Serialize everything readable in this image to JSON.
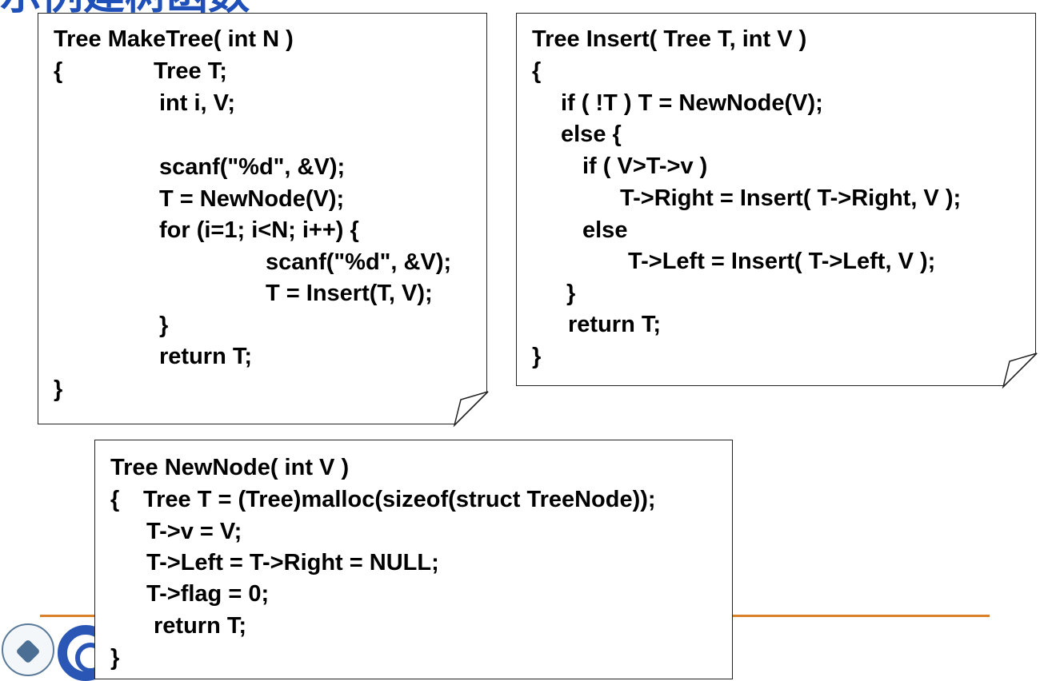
{
  "slide": {
    "title_fragment": "示例建树函数"
  },
  "make_tree": {
    "lines": [
      "Tree MakeTree( int N )",
      "{",
      "Tree T;",
      "int i, V;",
      "scanf(\"%d\", &V);",
      "T = NewNode(V);",
      "for (i=1; i<N; i++) {",
      "scanf(\"%d\", &V);",
      "T = Insert(T, V);",
      "}",
      "return T;",
      "}"
    ]
  },
  "insert": {
    "lines": [
      "Tree Insert( Tree T, int V )",
      "{",
      "if ( !T ) T = NewNode(V);",
      "else {",
      "if ( V>T->v )",
      "T->Right = Insert( T->Right, V );",
      "else",
      "T->Left = Insert( T->Left, V );",
      "}",
      "return T;",
      "}"
    ]
  },
  "new_node": {
    "lines": [
      "Tree NewNode( int V )",
      "{",
      "Tree T = (Tree)malloc(sizeof(struct TreeNode));",
      "T->v = V;",
      "T->Left = T->Right = NULL;",
      "T->flag = 0;",
      "return T;",
      "}"
    ]
  },
  "colors": {
    "title_blue": "#1f4fb8",
    "footer_line": "#d9822b",
    "logo_blue": "#2a56b5"
  }
}
